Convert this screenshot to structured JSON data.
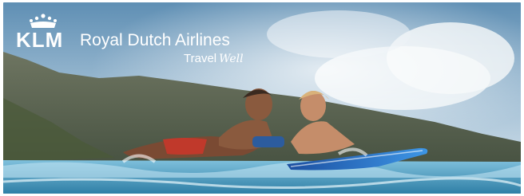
{
  "banner": {
    "brand": "KLM",
    "airline_name": "Royal Dutch Airlines",
    "tagline_travel": "Travel",
    "tagline_well": "Well",
    "image_subject": "adult and child lying on surfboards in the ocean with mountains behind"
  },
  "colors": {
    "sky": "#8fb6d2",
    "mountain": "#5b6a5a",
    "sea": "#5aa7c8",
    "surfboard": "#2e74c9",
    "logo": "#ffffff"
  }
}
